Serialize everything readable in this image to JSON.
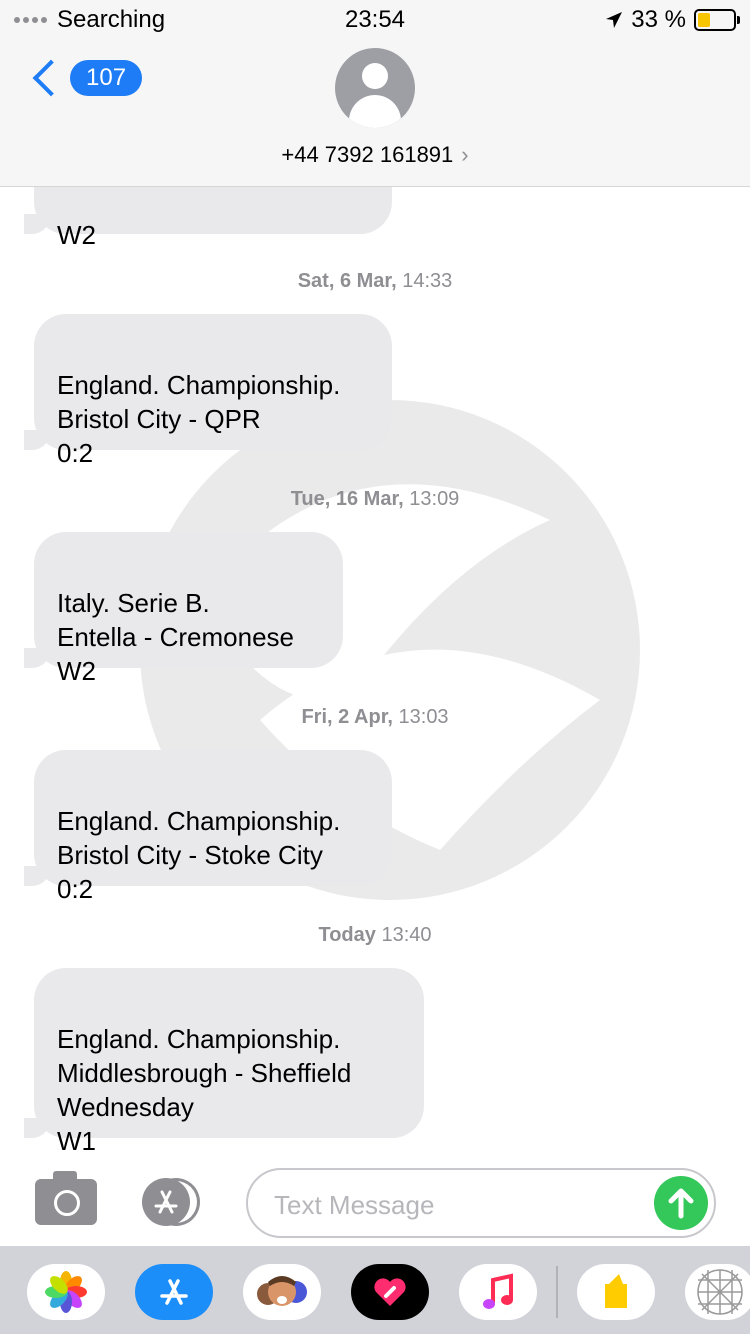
{
  "status_bar": {
    "carrier": "Searching",
    "time": "23:54",
    "battery": "33 %"
  },
  "header": {
    "back_count": "107",
    "contact": "+44 7392 161891",
    "contact_arrow": "›"
  },
  "messages": [
    {
      "text": "W2"
    },
    {
      "timestamp_day": "Sat, 6 Mar,",
      "timestamp_time": " 14:33",
      "text": "England. Championship.\nBristol City - QPR\n0:2"
    },
    {
      "timestamp_day": "Tue, 16 Mar,",
      "timestamp_time": " 13:09",
      "text": "Italy. Serie B.\nEntella - Cremonese\nW2"
    },
    {
      "timestamp_day": "Fri, 2 Apr,",
      "timestamp_time": " 13:03",
      "text": "England. Championship.\nBristol City - Stoke City\n0:2"
    },
    {
      "timestamp_day": "Today",
      "timestamp_time": " 13:40",
      "text": "England. Championship.\nMiddlesbrough - Sheffield\nWednesday\nW1"
    }
  ],
  "input": {
    "placeholder": "Text Message"
  },
  "colors": {
    "accent": "#1e7cf6",
    "bubble": "#e9e9eb",
    "send": "#34c759"
  },
  "app_drawer": [
    "photos-icon",
    "app-store-icon",
    "memoji-icon",
    "digital-touch-icon",
    "music-icon",
    "yellow-app-icon",
    "grid-app-icon"
  ]
}
